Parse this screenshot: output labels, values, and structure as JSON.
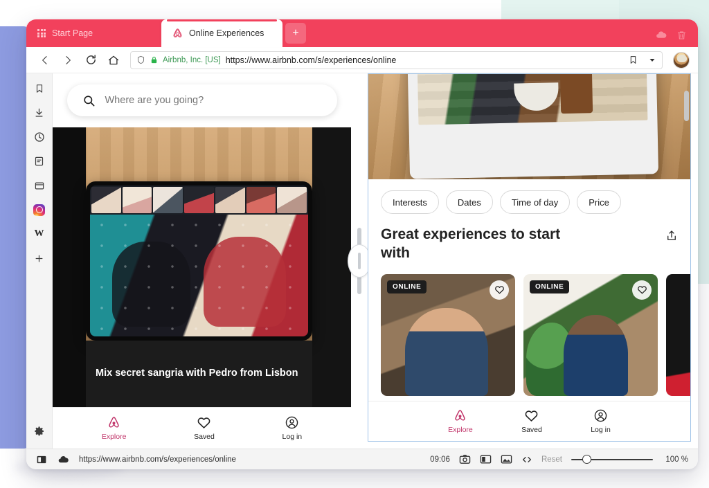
{
  "browser": {
    "tabs": [
      {
        "label": "Start Page",
        "icon": "grid-icon",
        "active": false
      },
      {
        "label": "Online Experiences",
        "icon": "airbnb-logo-icon",
        "active": true
      }
    ],
    "new_tab_label": "+",
    "tabbar_icons": [
      "cloud-icon",
      "trash-icon"
    ],
    "accent_color": "#f2415c",
    "nav": {
      "back": "back-icon",
      "forward": "forward-icon",
      "reload": "reload-icon",
      "home": "home-icon"
    },
    "omnibox": {
      "shield_icon": "shield-icon",
      "lock_icon": "lock-icon",
      "site_identity": "Airbnb, Inc. [US]",
      "url": "https://www.airbnb.com/s/experiences/online",
      "bookmark_icon": "bookmark-icon",
      "dropdown_icon": "chevron-down-icon"
    },
    "avatar": "user-avatar"
  },
  "sidebar": {
    "items": [
      {
        "name": "bookmarks",
        "icon": "bookmark-icon"
      },
      {
        "name": "downloads",
        "icon": "download-icon"
      },
      {
        "name": "history",
        "icon": "clock-icon"
      },
      {
        "name": "reading-list",
        "icon": "reading-list-icon"
      },
      {
        "name": "windows",
        "icon": "window-icon"
      },
      {
        "name": "instagram",
        "icon": "instagram-icon"
      },
      {
        "name": "wikipedia",
        "icon": "wikipedia-icon",
        "label": "W"
      },
      {
        "name": "add",
        "icon": "plus-icon",
        "label": "+"
      }
    ],
    "settings": {
      "name": "settings",
      "icon": "gear-icon"
    }
  },
  "left_viewport": {
    "search": {
      "placeholder": "Where are you going?",
      "icon": "search-icon"
    },
    "hero": {
      "caption": "Mix secret sangria with Pedro from Lisbon"
    },
    "bottom_nav": [
      {
        "label": "Explore",
        "icon": "airbnb-logo-icon",
        "active": true
      },
      {
        "label": "Saved",
        "icon": "heart-icon",
        "active": false
      },
      {
        "label": "Log in",
        "icon": "user-circle-icon",
        "active": false
      }
    ]
  },
  "right_viewport": {
    "filters": [
      "Interests",
      "Dates",
      "Time of day",
      "Price"
    ],
    "section_title": "Great experiences to start with",
    "share_icon": "share-icon",
    "cards": [
      {
        "badge": "ONLINE",
        "favorite_icon": "heart-icon"
      },
      {
        "badge": "ONLINE",
        "favorite_icon": "heart-icon"
      },
      {
        "badge": "",
        "favorite_icon": "heart-icon"
      }
    ],
    "bottom_nav": [
      {
        "label": "Explore",
        "icon": "airbnb-logo-icon",
        "active": true
      },
      {
        "label": "Saved",
        "icon": "heart-icon",
        "active": false
      },
      {
        "label": "Log in",
        "icon": "user-circle-icon",
        "active": false
      }
    ]
  },
  "statusbar": {
    "layout_icon": "split-layout-icon",
    "cloud_icon": "cloud-icon",
    "url": "https://www.airbnb.com/s/experiences/online",
    "time": "09:06",
    "icons": [
      "camera-icon",
      "split-view-icon",
      "image-icon",
      "code-icon"
    ],
    "reset_label": "Reset",
    "zoom_value": "100 %"
  }
}
